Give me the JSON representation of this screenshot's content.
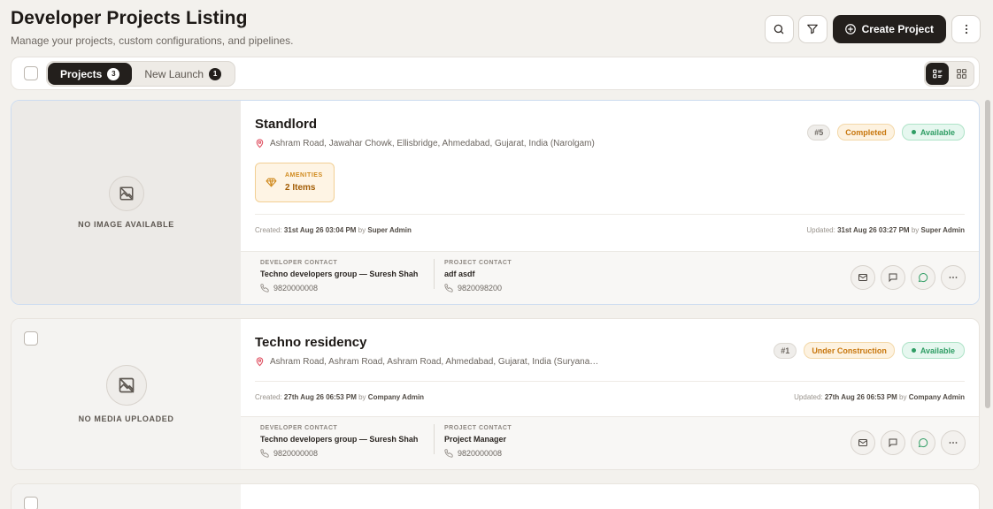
{
  "header": {
    "title": "Developer Projects Listing",
    "subtitle": "Manage your projects, custom configurations, and pipelines.",
    "create_label": "Create Project"
  },
  "tabs": [
    {
      "label": "Projects",
      "count": "3"
    },
    {
      "label": "New Launch",
      "count": "1"
    }
  ],
  "projects": [
    {
      "name": "Standlord",
      "address": "Ashram Road, Jawahar Chowk, Ellisbridge, Ahmedabad, Gujarat, India (Narolgam)",
      "id_badge": "#5",
      "status": "Completed",
      "availability": "Available",
      "media_label": "NO IMAGE AVAILABLE",
      "amenities_caption": "AMENITIES",
      "amenities_value": "2 Items",
      "created_prefix": "Created:",
      "created_at": "31st Aug 26 03:04 PM",
      "created_by": "Super Admin",
      "updated_prefix": "Updated:",
      "updated_at": "31st Aug 26 03:27 PM",
      "updated_by": "Super Admin",
      "by": "by",
      "dev_contact_caption": "DEVELOPER CONTACT",
      "dev_contact_name": "Techno developers group — Suresh Shah",
      "dev_contact_phone": "9820000008",
      "proj_contact_caption": "PROJECT CONTACT",
      "proj_contact_name": "adf asdf",
      "proj_contact_phone": "9820098200"
    },
    {
      "name": "Techno residency",
      "address": "Ashram Road, Ashram Road, Ashram Road, Ahmedabad, Gujarat, India (Suryana…",
      "id_badge": "#1",
      "status": "Under Construction",
      "availability": "Available",
      "media_label": "NO MEDIA UPLOADED",
      "created_prefix": "Created:",
      "created_at": "27th Aug 26 06:53 PM",
      "created_by": "Company Admin",
      "updated_prefix": "Updated:",
      "updated_at": "27th Aug 26 06:53 PM",
      "updated_by": "Company Admin",
      "by": "by",
      "dev_contact_caption": "DEVELOPER CONTACT",
      "dev_contact_name": "Techno developers group — Suresh Shah",
      "dev_contact_phone": "9820000008",
      "proj_contact_caption": "PROJECT CONTACT",
      "proj_contact_name": "Project Manager",
      "proj_contact_phone": "9820000008"
    }
  ],
  "icons": {
    "search": "search-icon",
    "filter": "filter-icon",
    "create": "plus-circle-icon",
    "more": "more-vertical-icon",
    "list_view": "list-view-icon",
    "grid_view": "grid-view-icon",
    "location": "map-pin-icon",
    "amenities": "diamond-icon",
    "phone": "phone-icon",
    "email": "mail-icon",
    "chat": "message-icon",
    "whatsapp": "whatsapp-icon",
    "more_horizontal": "more-horizontal-icon",
    "no_image": "image-off-icon"
  },
  "colors": {
    "primary": "#231f1c",
    "status_orange": "#c8770e",
    "available_green": "#2f9d64",
    "location_red": "#e05263"
  }
}
